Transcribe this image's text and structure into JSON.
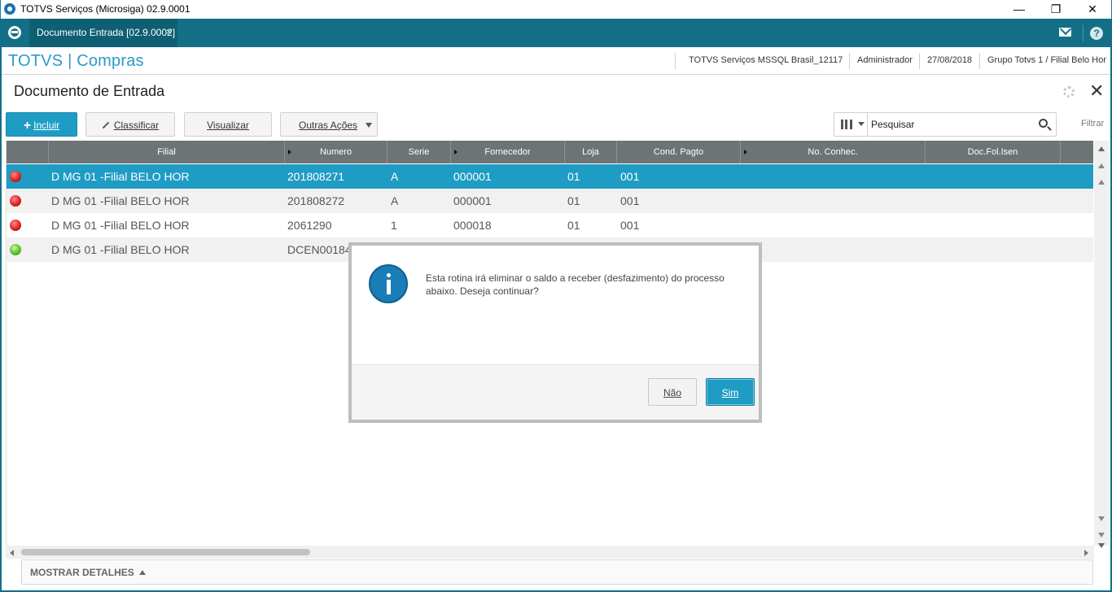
{
  "window": {
    "title": "TOTVS Serviços (Microsiga) 02.9.0001",
    "minimize": "—",
    "maximize": "❐",
    "close": "✕"
  },
  "tabbar": {
    "active_tab": "Documento Entrada [02.9.0002]",
    "tab_close": "×",
    "help": "?"
  },
  "header": {
    "brand": "TOTVS | Compras",
    "environment": "TOTVS Serviços MSSQL Brasil_12117",
    "user": "Administrador",
    "date": "27/08/2018",
    "branch": "Grupo Totvs 1 / Filial Belo Hor"
  },
  "page": {
    "title": "Documento de Entrada",
    "close": "✕"
  },
  "toolbar": {
    "incluir": "Incluir",
    "classificar": "Classificar",
    "visualizar": "Visualizar",
    "outras_acoes": "Outras Ações",
    "search_placeholder": "Pesquisar",
    "filtrar": "Filtrar"
  },
  "grid": {
    "columns": [
      "Filial",
      "Numero",
      "Serie",
      "Fornecedor",
      "Loja",
      "Cond. Pagto",
      "No. Conhec.",
      "Doc.Fol.Isen"
    ],
    "rows": [
      {
        "status": "red",
        "filial": "D MG 01 -Filial BELO HOR",
        "numero": "201808271",
        "serie": "A",
        "fornecedor": "000001",
        "loja": "01",
        "cond": "001"
      },
      {
        "status": "red",
        "filial": "D MG 01 -Filial BELO HOR",
        "numero": "201808272",
        "serie": "A",
        "fornecedor": "000001",
        "loja": "01",
        "cond": "001"
      },
      {
        "status": "red",
        "filial": "D MG 01 -Filial BELO HOR",
        "numero": "2061290",
        "serie": "1",
        "fornecedor": "000018",
        "loja": "01",
        "cond": "001"
      },
      {
        "status": "green",
        "filial": "D MG 01 -Filial BELO HOR",
        "numero": "DCEN00184",
        "serie": "",
        "fornecedor": "",
        "loja": "",
        "cond": ""
      }
    ],
    "selected_row": 0
  },
  "footer": {
    "details": "MOSTRAR DETALHES"
  },
  "dialog": {
    "message": "Esta rotina irá eliminar o saldo a receber (desfazimento) do processo abaixo. Deseja continuar?",
    "no": "Não",
    "yes": "Sim"
  },
  "colors": {
    "accent": "#1f9cc4",
    "tabbar": "#136f85",
    "grid_header": "#6d7476"
  }
}
